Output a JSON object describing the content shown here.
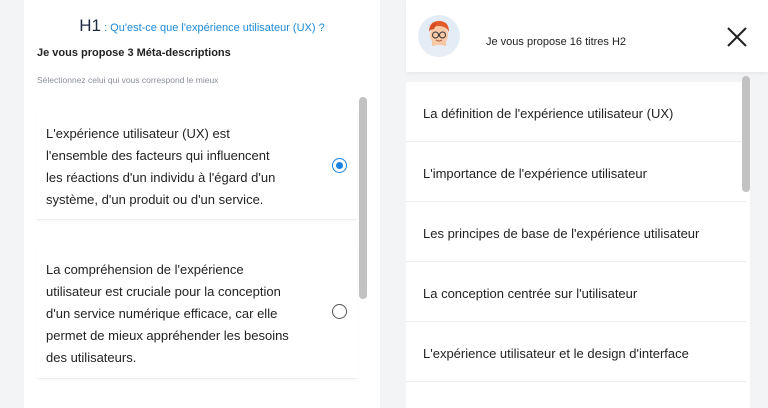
{
  "left": {
    "h1_tag": "H1",
    "h1_text": " : Qu'est-ce que l'expérience utilisateur (UX) ?",
    "heading": "Je vous propose 3 Méta-descriptions",
    "subheading": "Sélectionnez celui qui vous correspond le mieux",
    "options": [
      {
        "lines": [
          "L'expérience utilisateur (UX) est",
          "l'ensemble des facteurs qui influencent",
          "les réactions d'un individu à l'égard d'un",
          "système, d'un produit ou d'un service."
        ],
        "selected": true
      },
      {
        "lines": [
          "La compréhension de l'expérience",
          "utilisateur est cruciale pour la conception",
          "d'un service numérique efficace, car elle",
          "permet de mieux appréhender les besoins",
          "des utilisateurs."
        ],
        "selected": false
      }
    ]
  },
  "right": {
    "header_title": "Je vous propose 16 titres H2",
    "avatar_icon": "cartoon-avatar-icon",
    "close_icon": "close-icon",
    "titles": [
      "La définition de l'expérience utilisateur (UX)",
      "L'importance de l'expérience utilisateur",
      "Les principes de base de l'expérience utilisateur",
      "La conception centrée sur l'utilisateur",
      "L'expérience utilisateur et le design d'interface"
    ]
  },
  "colors": {
    "accent": "#1a82e2",
    "h1_link": "#1d8ad6",
    "background": "#f3f4f6"
  }
}
